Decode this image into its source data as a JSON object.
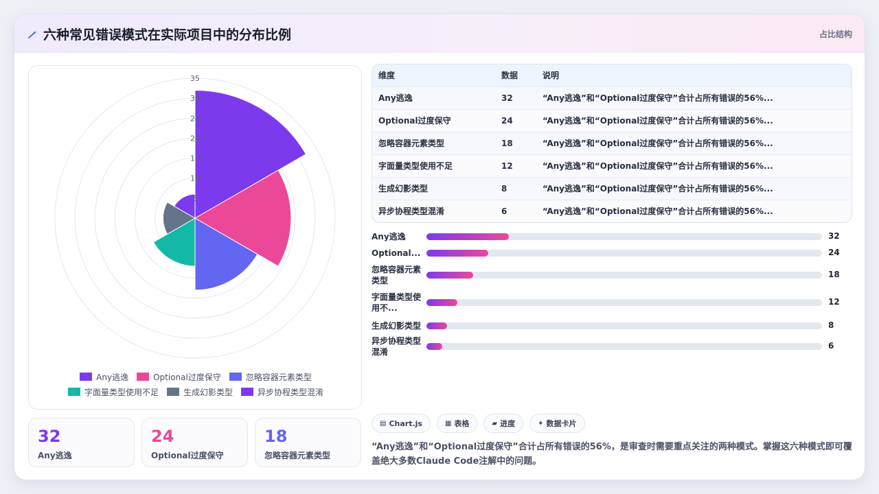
{
  "header": {
    "title": "六种常见错误模式在实际项目中的分布比例",
    "tag": "占比结构",
    "icon": "wand-icon"
  },
  "chart_data": {
    "type": "polarArea",
    "categories": [
      "Any逃逸",
      "Optional过度保守",
      "忽略容器元素类型",
      "字面量类型使用不足",
      "生成幻影类型",
      "异步协程类型混淆"
    ],
    "values": [
      32,
      24,
      18,
      12,
      8,
      6
    ],
    "colors": [
      "#7c3aed",
      "#ec4899",
      "#6366f1",
      "#14b8a6",
      "#64748b",
      "#7c3aed"
    ],
    "rlim": [
      0,
      35
    ],
    "ticks": [
      "5",
      "10",
      "15",
      "20",
      "25",
      "30",
      "35"
    ],
    "legend_position": "bottom",
    "grid": true
  },
  "stats": [
    {
      "value": "32",
      "label": "Any逃逸",
      "color": "#7c3aed"
    },
    {
      "value": "24",
      "label": "Optional过度保守",
      "color": "#ec4899"
    },
    {
      "value": "18",
      "label": "忽略容器元素类型",
      "color": "#6366f1"
    }
  ],
  "table": {
    "headers": [
      "维度",
      "数据",
      "说明"
    ],
    "rows": [
      [
        "Any逃逸",
        "32",
        "“Any逃逸”和“Optional过度保守”合计占所有错误的56%..."
      ],
      [
        "Optional过度保守",
        "24",
        "“Any逃逸”和“Optional过度保守”合计占所有错误的56%..."
      ],
      [
        "忽略容器元素类型",
        "18",
        "“Any逃逸”和“Optional过度保守”合计占所有错误的56%..."
      ],
      [
        "字面量类型使用不足",
        "12",
        "“Any逃逸”和“Optional过度保守”合计占所有错误的56%..."
      ],
      [
        "生成幻影类型",
        "8",
        "“Any逃逸”和“Optional过度保守”合计占所有错误的56%..."
      ],
      [
        "异步协程类型混淆",
        "6",
        "“Any逃逸”和“Optional过度保守”合计占所有错误的56%..."
      ]
    ]
  },
  "bars": {
    "max": 153,
    "items": [
      {
        "label1": "Any逃逸",
        "label2": "",
        "value": "32",
        "num": 32
      },
      {
        "label1": "Optional...",
        "label2": "",
        "value": "24",
        "num": 24
      },
      {
        "label1": "忽略容器元素",
        "label2": "类型",
        "value": "18",
        "num": 18
      },
      {
        "label1": "字面量类型使",
        "label2": "用不...",
        "value": "12",
        "num": 12
      },
      {
        "label1": "生成幻影类型",
        "label2": "",
        "value": "8",
        "num": 8
      },
      {
        "label1": "异步协程类型",
        "label2": "混淆",
        "value": "6",
        "num": 6
      }
    ]
  },
  "chips": [
    {
      "icon": "▤",
      "label": "Chart.js"
    },
    {
      "icon": "▦",
      "label": "表格"
    },
    {
      "icon": "▰",
      "label": "进度"
    },
    {
      "icon": "✦",
      "label": "数据卡片"
    }
  ],
  "note": "“Any逃逸”和“Optional过度保守”合计占所有错误的56%，是审查时需要重点关注的两种模式。掌握这六种模式即可覆盖绝大多数Claude Code注解中的问题。"
}
